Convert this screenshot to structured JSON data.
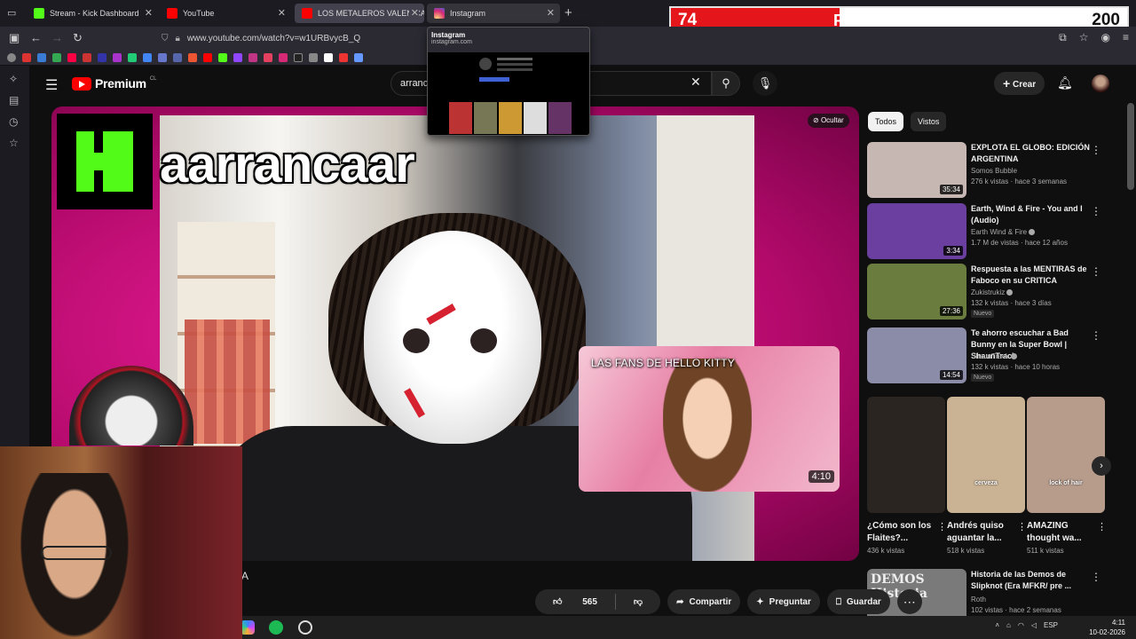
{
  "browser": {
    "tabs": [
      {
        "label": "Stream - Kick Dashboard",
        "icon": "kick-icon",
        "color": "#53fc18"
      },
      {
        "label": "YouTube",
        "icon": "youtube-icon",
        "color": "#ff0000"
      },
      {
        "label": "LOS METALEROS VALEN CALLA",
        "icon": "youtube-icon",
        "color": "#ff0000"
      },
      {
        "label": "Instagram",
        "icon": "instagram-icon",
        "color": "#d62976"
      }
    ],
    "url": "www.youtube.com/watch?v=w1URBvycB_Q",
    "tab_preview": {
      "title": "Instagram",
      "url": "instagram.com"
    }
  },
  "overlay_score": {
    "left_value": "74",
    "name": "PASTABASEROS",
    "right_value": "200",
    "fill_fraction": 0.37
  },
  "youtube": {
    "logo_text": "Premium",
    "logo_country": "CL",
    "search_value": "arranc",
    "create_label": "Crear"
  },
  "player": {
    "overlay_word": "aarrancaar",
    "hide_label": "Ocultar",
    "card": {
      "title": "LAS FANS DE HELLO KITTY",
      "duration": "4:10"
    },
    "partial_text": "A"
  },
  "actions": {
    "likes": "565",
    "share": "Compartir",
    "ask": "Preguntar",
    "save": "Guardar"
  },
  "sidebar": {
    "chips": [
      "Todos",
      "Vistos"
    ],
    "recommendations": [
      {
        "title": "EXPLOTA EL GLOBO: EDICIÓN ARGENTINA",
        "channel": "Somos Bubble",
        "meta": "276 k vistas · hace 3 semanas",
        "duration": "35:34",
        "color": "#c7b7b3",
        "verified": false,
        "new": ""
      },
      {
        "title": "Earth, Wind & Fire - You and I (Audio)",
        "channel": "Earth Wind & Fire",
        "meta": "1.7 M de vistas · hace 12 años",
        "duration": "3:34",
        "color": "#6b3fa0",
        "verified": true,
        "new": ""
      },
      {
        "title": "Respuesta a las MENTIRAS de Faboco en su CRITICA",
        "channel": "Zukistrukiz",
        "meta": "132 k vistas · hace 3 días",
        "duration": "27:36",
        "color": "#6a7d3f",
        "verified": true,
        "new": "Nuevo"
      },
      {
        "title": "Te ahorro escuchar a Bad Bunny en la Super Bowl | ShaunTrack",
        "channel": "ShaunTrack",
        "meta": "132 k vistas · hace 10 horas",
        "duration": "14:54",
        "color": "#8b8ca8",
        "verified": true,
        "new": "Nuevo"
      }
    ],
    "shorts": [
      {
        "title": "¿Cómo son los Flaites?...",
        "views": "436 k vistas",
        "color": "#2a2521",
        "caption": ""
      },
      {
        "title": "Andrés quiso aguantar la...",
        "views": "518 k vistas",
        "color": "#c9b394",
        "caption": "cerveza"
      },
      {
        "title": "AMAZING thought wa...",
        "views": "511 k vistas",
        "color": "#b79c8c",
        "caption": "lock of hair"
      }
    ],
    "last": {
      "title": "Historia de las Demos de Slipknot (Era MFKR/ pre ...",
      "channel": "Roth",
      "meta": "102 vistas · hace 2 semanas",
      "thumb_text": "DEMOS Historia",
      "color": "#7a7a7a"
    }
  },
  "taskbar": {
    "lang": "ESP",
    "time": "4:11",
    "date": "10-02-2026"
  }
}
